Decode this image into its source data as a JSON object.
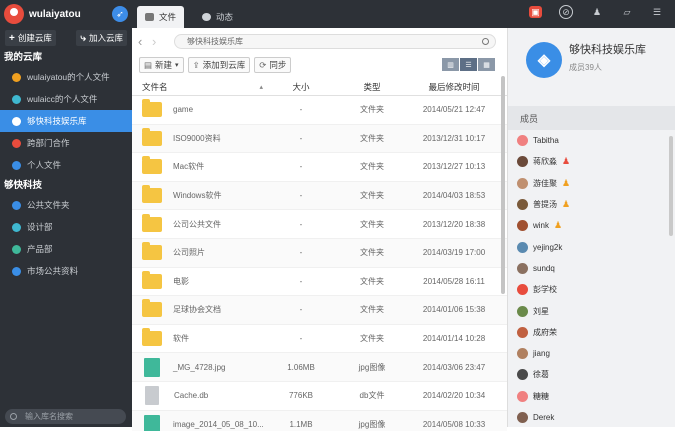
{
  "user": {
    "name": "wulaiyatou"
  },
  "sidebar": {
    "create_label": "创建云库",
    "join_label": "加入云库",
    "section1": "我的云库",
    "items1": [
      {
        "label": "wulaiyatou的个人文件",
        "color": "#f0a020"
      },
      {
        "label": "wulaicc的个人文件",
        "color": "#3fb8d0"
      },
      {
        "label": "够快科技娱乐库",
        "color": "#3a8ee6"
      },
      {
        "label": "跨部门合作",
        "color": "#e84c3d"
      },
      {
        "label": "个人文件",
        "color": "#3a8ee6"
      }
    ],
    "section2": "够快科技",
    "items2": [
      {
        "label": "公共文件夹",
        "color": "#3a8ee6"
      },
      {
        "label": "设计部",
        "color": "#3fb8d0"
      },
      {
        "label": "产品部",
        "color": "#3fb89a"
      },
      {
        "label": "市场公共资料",
        "color": "#3a8ee6"
      }
    ],
    "search_placeholder": "输入库名搜索"
  },
  "tabs": {
    "files": "文件",
    "activity": "动态"
  },
  "path": "够快科技娱乐库",
  "toolbar": {
    "new": "新建",
    "add": "添加到云库",
    "sync": "同步"
  },
  "table": {
    "headers": {
      "name": "文件名",
      "size": "大小",
      "type": "类型",
      "date": "最后修改时间"
    },
    "rows": [
      {
        "name": "game",
        "size": "-",
        "type": "文件夹",
        "date": "2014/05/21 12:47",
        "kind": "folder"
      },
      {
        "name": "ISO9000资料",
        "size": "-",
        "type": "文件夹",
        "date": "2013/12/31 10:17",
        "kind": "folder"
      },
      {
        "name": "Mac软件",
        "size": "-",
        "type": "文件夹",
        "date": "2013/12/27 10:13",
        "kind": "folder"
      },
      {
        "name": "Windows软件",
        "size": "-",
        "type": "文件夹",
        "date": "2014/04/03 18:53",
        "kind": "folder"
      },
      {
        "name": "公司公共文件",
        "size": "-",
        "type": "文件夹",
        "date": "2013/12/20 18:38",
        "kind": "folder"
      },
      {
        "name": "公司照片",
        "size": "-",
        "type": "文件夹",
        "date": "2014/03/19 17:00",
        "kind": "folder"
      },
      {
        "name": "电影",
        "size": "-",
        "type": "文件夹",
        "date": "2014/05/28 16:11",
        "kind": "folder"
      },
      {
        "name": "足球协会文档",
        "size": "-",
        "type": "文件夹",
        "date": "2014/01/06 15:38",
        "kind": "folder"
      },
      {
        "name": "软件",
        "size": "-",
        "type": "文件夹",
        "date": "2014/01/14 10:28",
        "kind": "folder"
      },
      {
        "name": "_MG_4728.jpg",
        "size": "1.06MB",
        "type": "jpg图像",
        "date": "2014/03/06 23:47",
        "kind": "image"
      },
      {
        "name": "Cache.db",
        "size": "776KB",
        "type": "db文件",
        "date": "2014/02/20 10:34",
        "kind": "db"
      },
      {
        "name": "image_2014_05_08_10...",
        "size": "1.1MB",
        "type": "jpg图像",
        "date": "2014/05/08 10:33",
        "kind": "image"
      }
    ]
  },
  "library": {
    "name": "够快科技娱乐库",
    "member_count": "成员39人"
  },
  "members_header": "成员",
  "members": [
    {
      "name": "Tabitha",
      "color": "#f08080",
      "badge": ""
    },
    {
      "name": "蒋欣淼",
      "color": "#6b4a3a",
      "badge": "red"
    },
    {
      "name": "游佳聚",
      "color": "#c09070",
      "badge": "orange"
    },
    {
      "name": "普提汤",
      "color": "#7a5a3a",
      "badge": "orange"
    },
    {
      "name": "wink",
      "color": "#a05030",
      "badge": "orange"
    },
    {
      "name": "yejing2k",
      "color": "#5a8ab0",
      "badge": ""
    },
    {
      "name": "sundq",
      "color": "#8a7060",
      "badge": ""
    },
    {
      "name": "彭学校",
      "color": "#e84c3d",
      "badge": ""
    },
    {
      "name": "刘星",
      "color": "#6a8a4a",
      "badge": ""
    },
    {
      "name": "成府荣",
      "color": "#c06040",
      "badge": ""
    },
    {
      "name": "jiang",
      "color": "#b08060",
      "badge": ""
    },
    {
      "name": "徐葛",
      "color": "#4a4a4a",
      "badge": ""
    },
    {
      "name": "糖糖",
      "color": "#f08080",
      "badge": ""
    },
    {
      "name": "Derek",
      "color": "#806050",
      "badge": ""
    }
  ]
}
